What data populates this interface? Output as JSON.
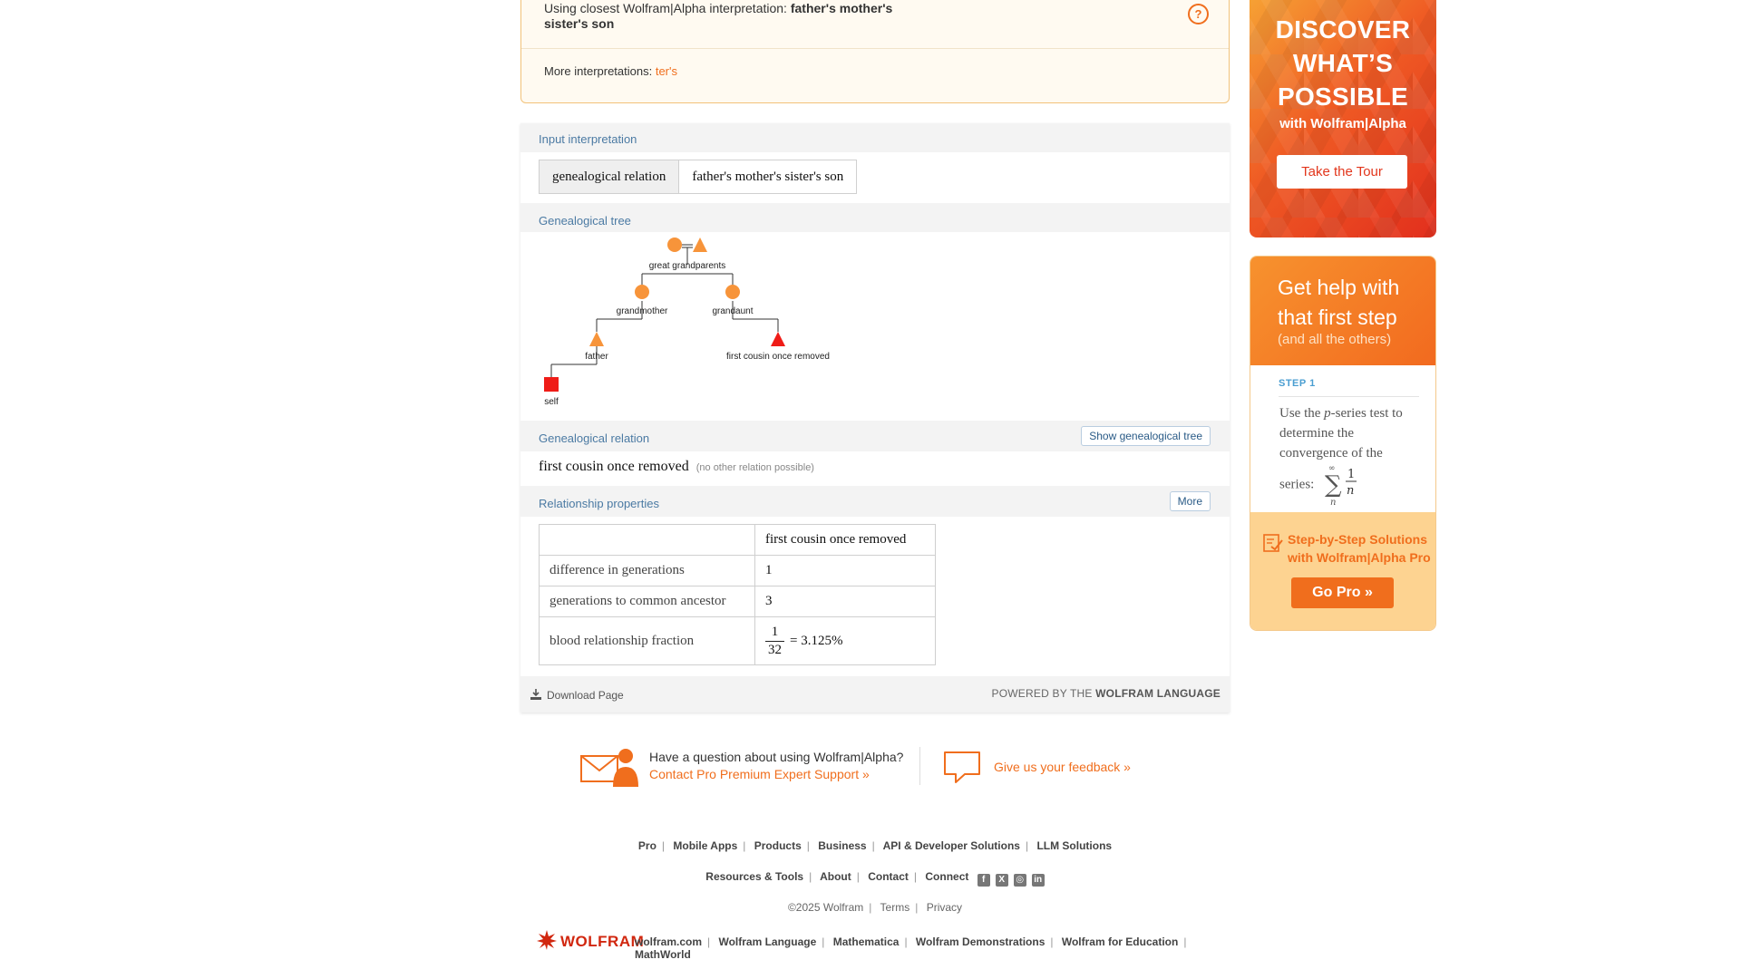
{
  "notice": {
    "prefix": "Using closest Wolfram|Alpha interpretation: ",
    "query": "father's mother's sister's son",
    "more_label": "More interpretations: ",
    "more_link": "ter's"
  },
  "pods": {
    "input_interpretation": {
      "title": "Input interpretation",
      "cells": [
        "genealogical relation",
        "father's mother's sister's son"
      ]
    },
    "genealogical_tree": {
      "title": "Genealogical tree",
      "nodes": {
        "great_grandparents": "great grandparents",
        "grandmother": "grandmother",
        "grandaunt": "grandaunt",
        "father": "father",
        "cousin": "first cousin once removed",
        "self": "self"
      },
      "colors": {
        "ancestor": "#f7943a",
        "target": "#ef1c17"
      }
    },
    "genealogical_relation": {
      "title": "Genealogical relation",
      "button": "Show genealogical tree",
      "value": "first cousin once removed",
      "note": "(no other relation possible)"
    },
    "relationship_properties": {
      "title": "Relationship properties",
      "button": "More",
      "header": "first cousin once removed",
      "rows": [
        {
          "label": "difference in generations",
          "value": "1"
        },
        {
          "label": "generations to common ancestor",
          "value": "3"
        },
        {
          "label": "blood relationship fraction",
          "numerator": "1",
          "denominator": "32",
          "value": "= 3.125%"
        }
      ]
    },
    "footer": {
      "download": "Download Page",
      "powered_prefix": "POWERED BY THE ",
      "powered_brand": "WOLFRAM LANGUAGE"
    }
  },
  "contact": {
    "question": "Have a question about using Wolfram|Alpha?",
    "support_link": "Contact Pro Premium Expert Support »",
    "feedback": "Give us your feedback »"
  },
  "footer": {
    "row1": [
      "Pro",
      "Mobile Apps",
      "Products",
      "Business",
      "API & Developer Solutions",
      "LLM Solutions"
    ],
    "row2": [
      "Resources & Tools",
      "About",
      "Contact",
      "Connect"
    ],
    "row3": [
      "©2025  Wolfram",
      "Terms",
      "Privacy"
    ],
    "brand": "WOLFRAM",
    "row4": [
      "wolfram.com",
      "Wolfram Language",
      "Mathematica",
      "Wolfram Demonstrations",
      "Wolfram for Education",
      "MathWorld"
    ]
  },
  "ads": {
    "discover": {
      "title_lines": [
        "DISCOVER",
        "WHAT’S",
        "POSSIBLE"
      ],
      "subtitle": "with Wolfram|Alpha",
      "button": "Take the Tour"
    },
    "help": {
      "title_lines": [
        "Get help with",
        "that first step"
      ],
      "subtitle": "(and all the others)",
      "step": "STEP 1",
      "body_pre": "Use the ",
      "body_var": "p",
      "body_post": "-series test to determine the convergence of the series:",
      "promo_lines": [
        "Step-by-Step Solutions",
        "with Wolfram|Alpha Pro"
      ],
      "button": "Go Pro »"
    }
  },
  "accent_colors": {
    "orange": "#f06e1d",
    "pod_title": "#4b7aa3",
    "wolfram_red": "#d1270f"
  }
}
